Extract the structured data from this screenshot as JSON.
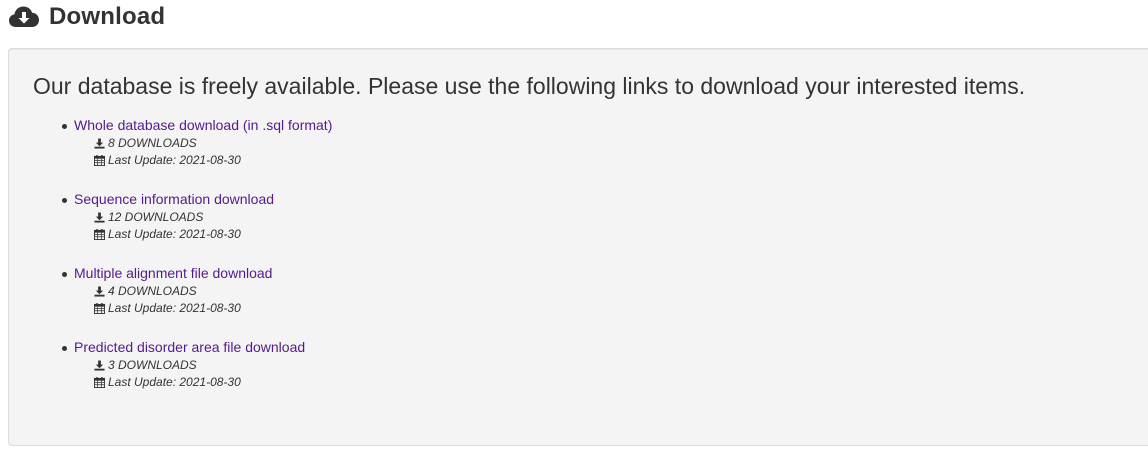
{
  "header": {
    "icon": "cloud-download-icon",
    "title": "Download"
  },
  "well": {
    "lead": "Our database is freely available. Please use the following links to download your interested items."
  },
  "items": [
    {
      "link": "Whole database download (in .sql format)",
      "downloads": "8 DOWNLOADS",
      "updated": "Last Update: 2021-08-30"
    },
    {
      "link": "Sequence information download",
      "downloads": "12 DOWNLOADS",
      "updated": "Last Update: 2021-08-30"
    },
    {
      "link": "Multiple alignment file download",
      "downloads": "4 DOWNLOADS",
      "updated": "Last Update: 2021-08-30"
    },
    {
      "link": "Predicted disorder area file download",
      "downloads": "3 DOWNLOADS",
      "updated": "Last Update: 2021-08-30"
    }
  ],
  "colors": {
    "link": "#551a8b",
    "text": "#333333",
    "well_background": "#f4f4f4"
  }
}
